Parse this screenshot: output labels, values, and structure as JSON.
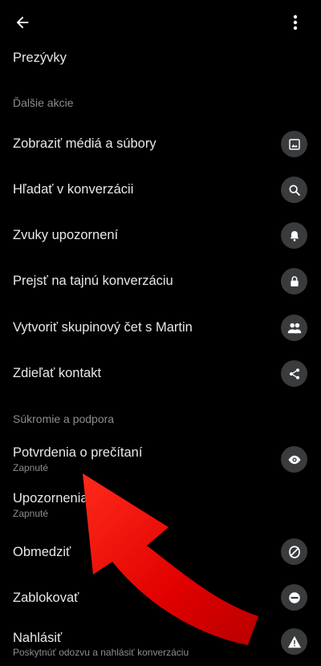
{
  "header": {
    "back_icon": "arrow-left-icon",
    "more_icon": "more-vertical-icon"
  },
  "top_item": {
    "label": "Prezývky"
  },
  "section_more_actions": {
    "title": "Ďalšie akcie",
    "items": [
      {
        "label": "Zobraziť médiá a súbory",
        "icon": "image-icon"
      },
      {
        "label": "Hľadať v konverzácii",
        "icon": "search-icon"
      },
      {
        "label": "Zvuky upozornení",
        "icon": "bell-icon"
      },
      {
        "label": "Prejsť na tajnú konverzáciu",
        "icon": "lock-icon"
      },
      {
        "label": "Vytvoriť skupinový čet s Martin",
        "icon": "group-icon"
      },
      {
        "label": "Zdieľať kontakt",
        "icon": "share-icon"
      }
    ]
  },
  "section_privacy": {
    "title": "Súkromie a podpora",
    "items": [
      {
        "label": "Potvrdenia o prečítaní",
        "sub": "Zapnuté",
        "icon": "eye-icon"
      },
      {
        "label": "Upozornenia",
        "sub": "Zapnuté"
      },
      {
        "label": "Obmedziť",
        "icon": "restrict-icon"
      },
      {
        "label": "Zablokovať",
        "icon": "block-icon"
      },
      {
        "label": "Nahlásiť",
        "sub": "Poskytnúť odozvu a nahlásiť konverzáciu",
        "icon": "warning-icon"
      }
    ]
  },
  "overlay": {
    "annotation_arrow_color": "#e00000"
  }
}
